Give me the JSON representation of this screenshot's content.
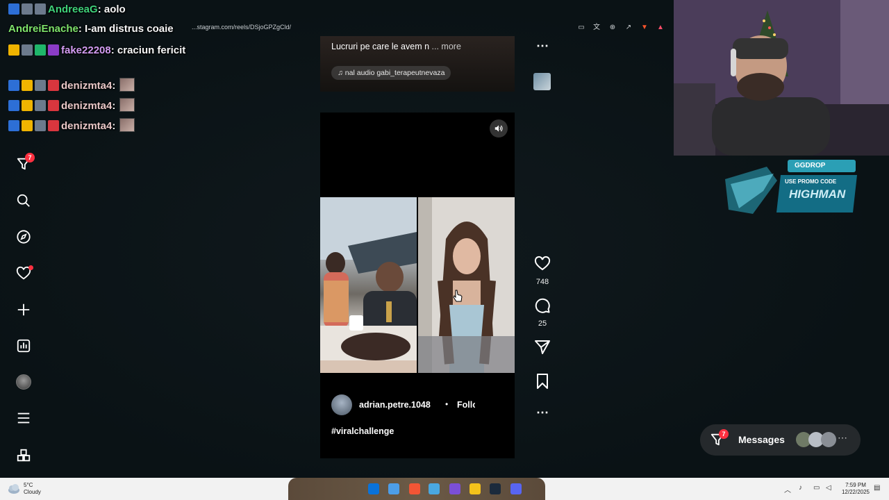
{
  "browser": {
    "url": "...stagram.com/reels/DSjoGPZgCld/"
  },
  "chat": [
    {
      "user": "AndreeaG",
      "text": "aolo",
      "color": "#3fd27a"
    },
    {
      "user": "AndreiEnache",
      "text": "I-am distrus coaie",
      "color": "#7ee36b"
    },
    {
      "user": "fake22208",
      "text": "craciun fericit",
      "color": "#d39cf2"
    },
    {
      "user": "denizmta4",
      "text": "",
      "color": "#e8c7c7"
    },
    {
      "user": "denizmta4",
      "text": "",
      "color": "#e8c7c7"
    },
    {
      "user": "denizmta4",
      "text": "",
      "color": "#e8c7c7"
    }
  ],
  "chat_sep": ":",
  "sidebar": {
    "notifications_badge": "7",
    "items": [
      "filter-icon",
      "search-icon",
      "compass-icon",
      "heart-icon",
      "plus-icon",
      "stats-icon",
      "avatar",
      "menu-icon",
      "apps-icon"
    ]
  },
  "prev_reel": {
    "caption": "Lucruri pe care le avem n",
    "more": "... more",
    "audio": "nal audio  gabi_terapeutnevaza"
  },
  "reel": {
    "author": "adrian.petre.1048",
    "separator": "•",
    "follow": "Follow",
    "caption": "#viralchallenge",
    "likes": "748",
    "comments": "25"
  },
  "promo": {
    "brand": "GGDROP",
    "line1": "USE PROMO CODE",
    "code": "HIGHMAN"
  },
  "messages": {
    "label": "Messages",
    "badge": "7"
  },
  "taskbar": {
    "temp": "5°C",
    "weather": "Cloudy",
    "time": "7:59 PM",
    "date": "12/22/2025"
  },
  "colors": {
    "accent_red": "#ff3040",
    "background": "#0b1418"
  }
}
